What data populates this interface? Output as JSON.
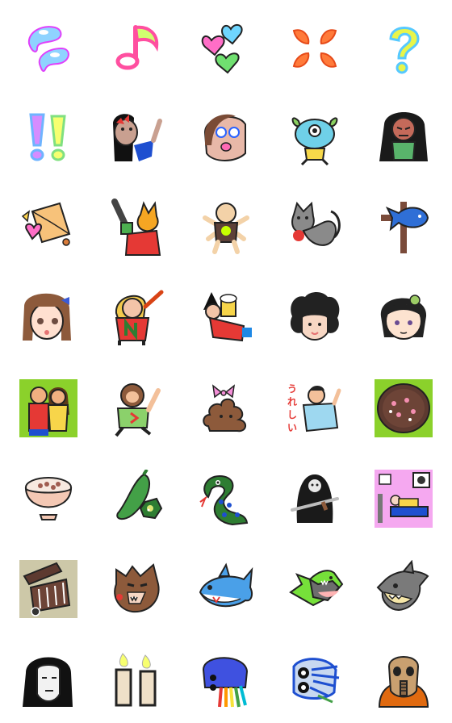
{
  "sheet": {
    "rows": 8,
    "columns": 5,
    "emoji": [
      {
        "icon": "water-drops-icon"
      },
      {
        "icon": "music-note-icon"
      },
      {
        "icon": "three-hearts-icon"
      },
      {
        "icon": "anger-mark-icon"
      },
      {
        "icon": "question-mark-icon"
      },
      {
        "icon": "double-exclamation-icon"
      },
      {
        "icon": "girl-red-bow-icon"
      },
      {
        "icon": "bald-face-icon"
      },
      {
        "icon": "one-eyed-monster-icon"
      },
      {
        "icon": "long-hair-girl-icon"
      },
      {
        "icon": "origami-heart-icon"
      },
      {
        "icon": "cat-chainsaw-icon"
      },
      {
        "icon": "baby-u-shirt-icon"
      },
      {
        "icon": "gray-cat-icon"
      },
      {
        "icon": "fish-cross-icon"
      },
      {
        "icon": "brown-hair-girl-icon"
      },
      {
        "icon": "blonde-n-hero-icon"
      },
      {
        "icon": "witch-beer-icon"
      },
      {
        "icon": "afro-face-icon"
      },
      {
        "icon": "green-clip-girl-icon"
      },
      {
        "icon": "hugging-couple-icon"
      },
      {
        "icon": "monkey-kid-icon"
      },
      {
        "icon": "poop-bow-icon"
      },
      {
        "icon": "ureshii-man-icon",
        "text": "うれしい"
      },
      {
        "icon": "bean-pie-icon"
      },
      {
        "icon": "rice-bowl-icon"
      },
      {
        "icon": "green-pepper-okra-icon"
      },
      {
        "icon": "polka-dot-snake-icon"
      },
      {
        "icon": "reaper-sword-icon"
      },
      {
        "icon": "pink-room-icon"
      },
      {
        "icon": "pressure-cooker-icon"
      },
      {
        "icon": "brown-wolf-icon"
      },
      {
        "icon": "blue-shark-icon"
      },
      {
        "icon": "green-shark-icon"
      },
      {
        "icon": "gray-shark-icon"
      },
      {
        "icon": "long-black-hair-ghost-icon"
      },
      {
        "icon": "two-candles-icon"
      },
      {
        "icon": "rainbow-tentacle-icon"
      },
      {
        "icon": "blue-scribble-face-icon"
      },
      {
        "icon": "gas-mask-icon"
      }
    ]
  }
}
